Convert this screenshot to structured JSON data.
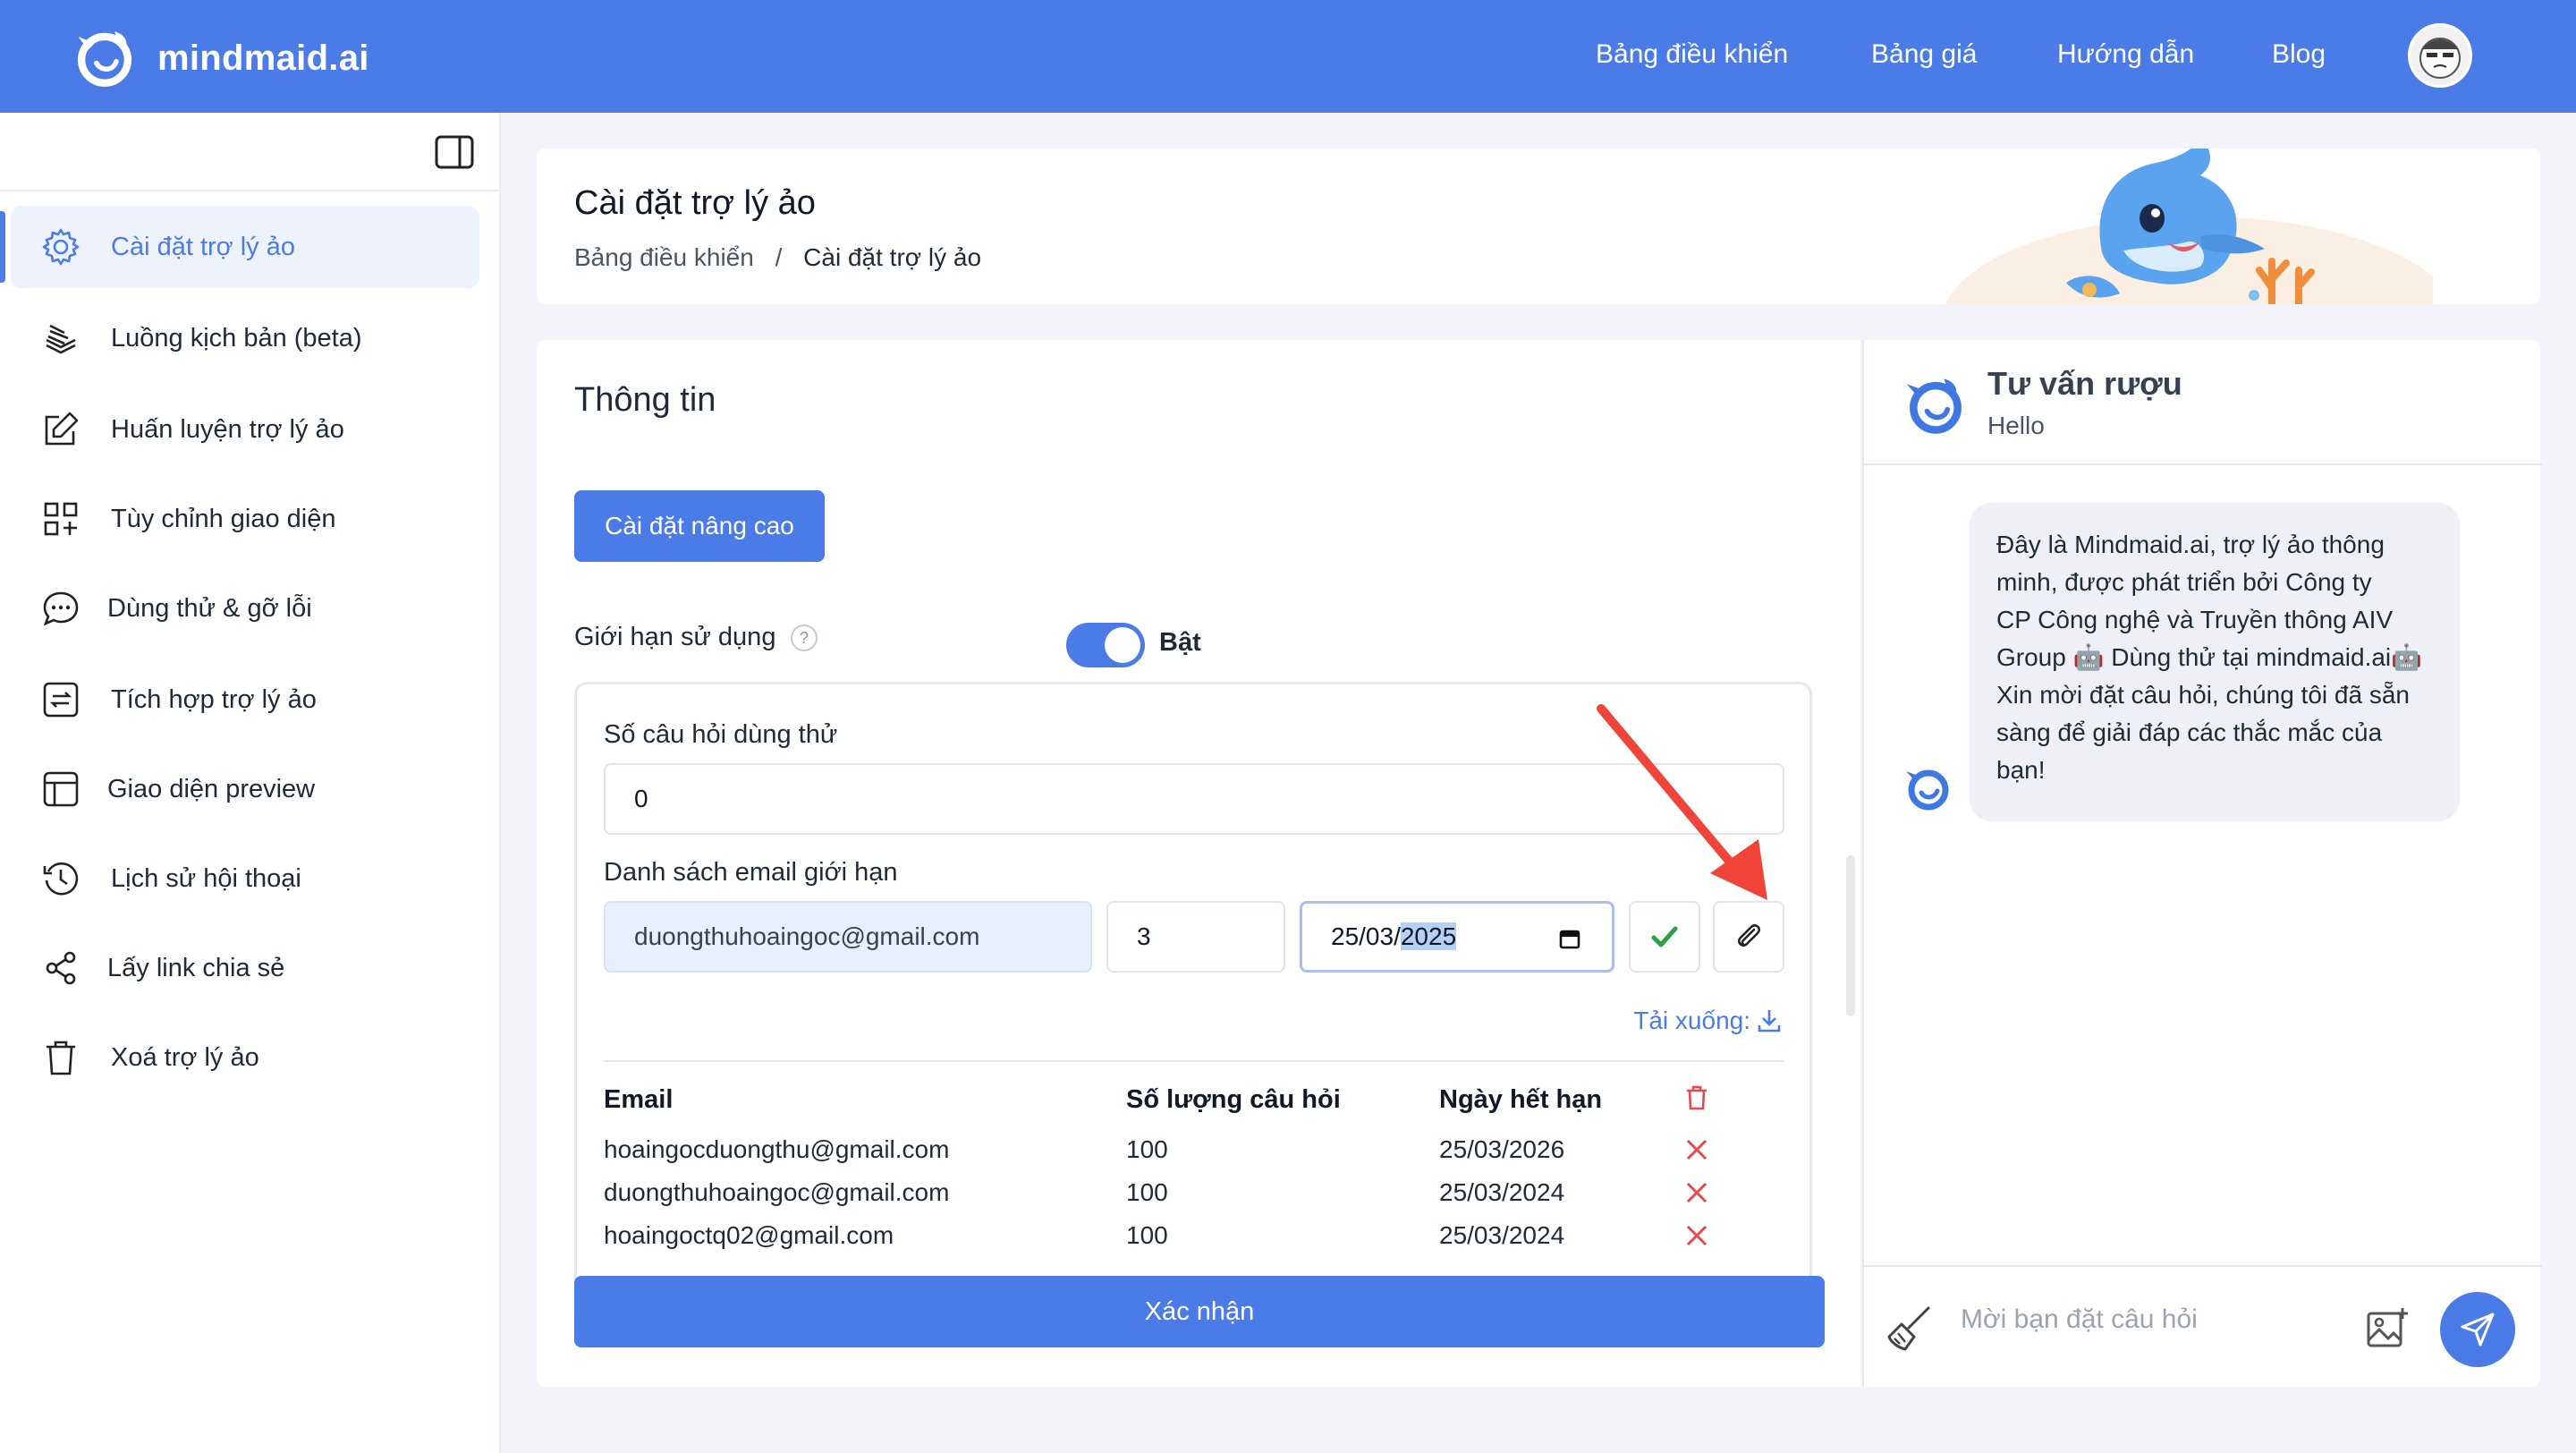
{
  "brand": {
    "name": "mindmaid.ai",
    "accent": "#4b7be6"
  },
  "nav": {
    "links": [
      "Bảng điều khiển",
      "Bảng giá",
      "Hướng dẫn",
      "Blog"
    ]
  },
  "sidebar": {
    "items": [
      {
        "label": "Cài đặt trợ lý ảo",
        "icon": "gear-icon",
        "active": true
      },
      {
        "label": "Luồng kịch bản (beta)",
        "icon": "stack-icon"
      },
      {
        "label": "Huấn luyện trợ lý ảo",
        "icon": "edit-icon"
      },
      {
        "label": "Tùy chỉnh giao diện",
        "icon": "grid-plus-icon"
      },
      {
        "label": "Dùng thử & gỡ lỗi",
        "icon": "chat-icon"
      },
      {
        "label": "Tích hợp trợ lý ảo",
        "icon": "integration-icon"
      },
      {
        "label": "Giao diện preview",
        "icon": "layout-icon"
      },
      {
        "label": "Lịch sử hội thoại",
        "icon": "history-icon"
      },
      {
        "label": "Lấy link chia sẻ",
        "icon": "share-icon"
      },
      {
        "label": "Xoá trợ lý ảo",
        "icon": "trash-icon"
      }
    ]
  },
  "header": {
    "title": "Cài đặt trợ lý ảo",
    "breadcrumb": [
      "Bảng điều khiển",
      "/",
      "Cài đặt trợ lý ảo"
    ]
  },
  "form": {
    "section_title": "Thông tin",
    "advanced_button": "Cài đặt nâng cao",
    "usage_limit_label": "Giới hạn sử dụng",
    "help": "?",
    "usage_limit_enabled": true,
    "toggle_label": "Bật",
    "trial_questions_label": "Số câu hỏi dùng thử",
    "trial_questions_value": "0",
    "email_list_label": "Danh sách email giới hạn",
    "new_email": "duongthuhoaingoc@gmail.com",
    "new_count": "3",
    "new_date_prefix": "25/03/",
    "new_date_year": "2025",
    "download_label": "Tải xuống:",
    "table": {
      "headers": [
        "Email",
        "Số lượng câu hỏi",
        "Ngày hết hạn"
      ],
      "rows": [
        [
          "hoaingocduongthu@gmail.com",
          "100",
          "25/03/2026"
        ],
        [
          "duongthuhoaingoc@gmail.com",
          "100",
          "25/03/2024"
        ],
        [
          "hoaingoctq02@gmail.com",
          "100",
          "25/03/2024"
        ]
      ]
    },
    "confirm_button": "Xác nhận"
  },
  "chat": {
    "title": "Tư vấn rượu",
    "subtitle": "Hello",
    "message_lines": [
      "Đây là Mindmaid.ai, trợ lý ảo thông",
      "minh, được phát triển bởi Công ty",
      "CP Công nghệ và Truyền thông AIV",
      "Group 🤖 Dùng thử tại mindmaid.ai🤖",
      "Xin mời đặt câu hỏi, chúng tôi đã sẵn",
      "sàng để giải đáp các thắc mắc của",
      "bạn!"
    ],
    "input_placeholder": "Mời bạn đặt câu hỏi"
  },
  "colors": {
    "delete_red": "#e5484d",
    "check_green": "#2f9e44",
    "annotation_arrow": "#f0443a"
  }
}
